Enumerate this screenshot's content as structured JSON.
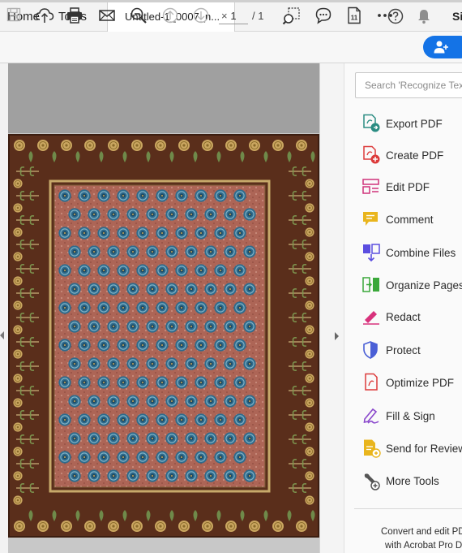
{
  "tabs": {
    "home": "Home",
    "tools": "Tools",
    "document": "Untitled-1_0007_n...",
    "close": "×"
  },
  "header": {
    "sign_in": "Si"
  },
  "toolbar": {
    "page_current": "1",
    "page_total": "/ 1"
  },
  "panel": {
    "search_placeholder": "Search 'Recognize Text'",
    "tools": [
      {
        "label": "Export PDF",
        "icon": "export-pdf-icon",
        "color": "#2a8c82"
      },
      {
        "label": "Create PDF",
        "icon": "create-pdf-icon",
        "color": "#dc3b3b"
      },
      {
        "label": "Edit PDF",
        "icon": "edit-pdf-icon",
        "color": "#d0337a"
      },
      {
        "label": "Comment",
        "icon": "comment-icon",
        "color": "#e9b51d"
      },
      {
        "label": "Combine Files",
        "icon": "combine-files-icon",
        "color": "#5b4ee0"
      },
      {
        "label": "Organize Pages",
        "icon": "organize-pages-icon",
        "color": "#3aa83a"
      },
      {
        "label": "Redact",
        "icon": "redact-icon",
        "color": "#d8327c"
      },
      {
        "label": "Protect",
        "icon": "protect-icon",
        "color": "#4a5fd6"
      },
      {
        "label": "Optimize PDF",
        "icon": "optimize-pdf-icon",
        "color": "#dc3b3b"
      },
      {
        "label": "Fill & Sign",
        "icon": "fill-sign-icon",
        "color": "#8a48cc"
      },
      {
        "label": "Send for Review",
        "icon": "send-review-icon",
        "color": "#e9b51d"
      },
      {
        "label": "More Tools",
        "icon": "more-tools-icon",
        "color": "#555555"
      }
    ],
    "promo_line1": "Convert and edit PDF",
    "promo_line2": "with Acrobat Pro DC"
  },
  "colors": {
    "accent": "#1473e6",
    "border_brown": "#5a2e1b",
    "field_rose": "#b06a5c",
    "flower_blue": "#2f6b8c",
    "gold": "#c9a85a"
  }
}
